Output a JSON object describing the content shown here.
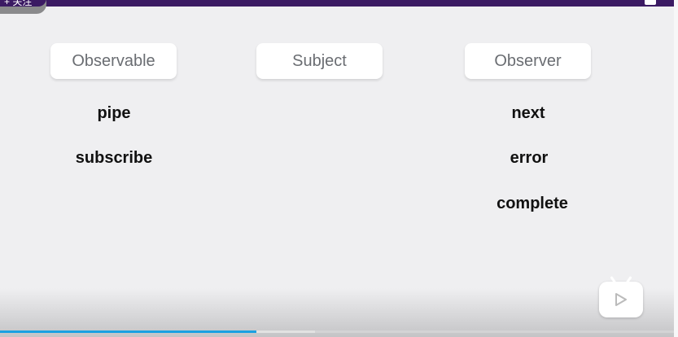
{
  "header": {
    "follow_label": "+ 关注"
  },
  "columns": [
    {
      "title": "Observable",
      "items": [
        "pipe",
        "subscribe"
      ]
    },
    {
      "title": "Subject",
      "items": []
    },
    {
      "title": "Observer",
      "items": [
        "next",
        "error",
        "complete"
      ]
    }
  ],
  "player": {
    "progress_percent": 38,
    "buffered_percent": 46.7,
    "accent": "#1ba1e2"
  }
}
